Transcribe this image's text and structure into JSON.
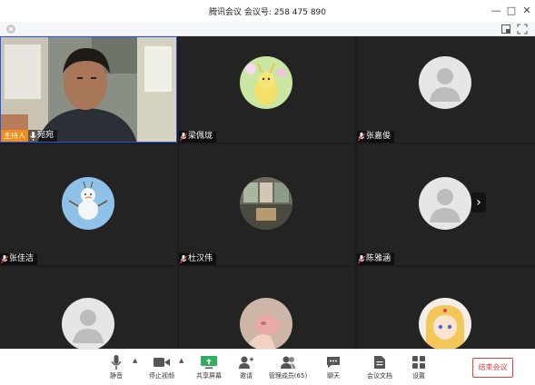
{
  "window": {
    "title": "腾讯会议  会议号: 258 475 890",
    "minimize_glyph": "—",
    "maximize_glyph": "□",
    "close_glyph": "✕"
  },
  "participants": [
    {
      "name": "宛宛",
      "host_label": "主持人",
      "video": "camera"
    },
    {
      "name": "梁佩珑",
      "video": "avatar-cartoon"
    },
    {
      "name": "张嘉俊",
      "video": "avatar-default"
    },
    {
      "name": "张佳洁",
      "video": "avatar-snowman"
    },
    {
      "name": "杜汉伟",
      "video": "avatar-photo"
    },
    {
      "name": "陈雅涵",
      "video": "avatar-default"
    },
    {
      "name": "",
      "video": "avatar-default"
    },
    {
      "name": "",
      "video": "avatar-photo-hand"
    },
    {
      "name": "",
      "video": "avatar-anime"
    }
  ],
  "next_page_glyph": "›",
  "toolbar": {
    "mute": "静音",
    "stop_video": "停止视频",
    "share_screen": "共享屏幕",
    "invite": "邀请",
    "manage_members": "管理成员(65)",
    "chat": "聊天",
    "documents": "会议文档",
    "settings": "设置",
    "end_meeting": "结束会议",
    "caret_glyph": "▲"
  },
  "colors": {
    "host_badge": "#f08c1b",
    "end_button": "#e04343",
    "active_border": "#2b54d8"
  }
}
